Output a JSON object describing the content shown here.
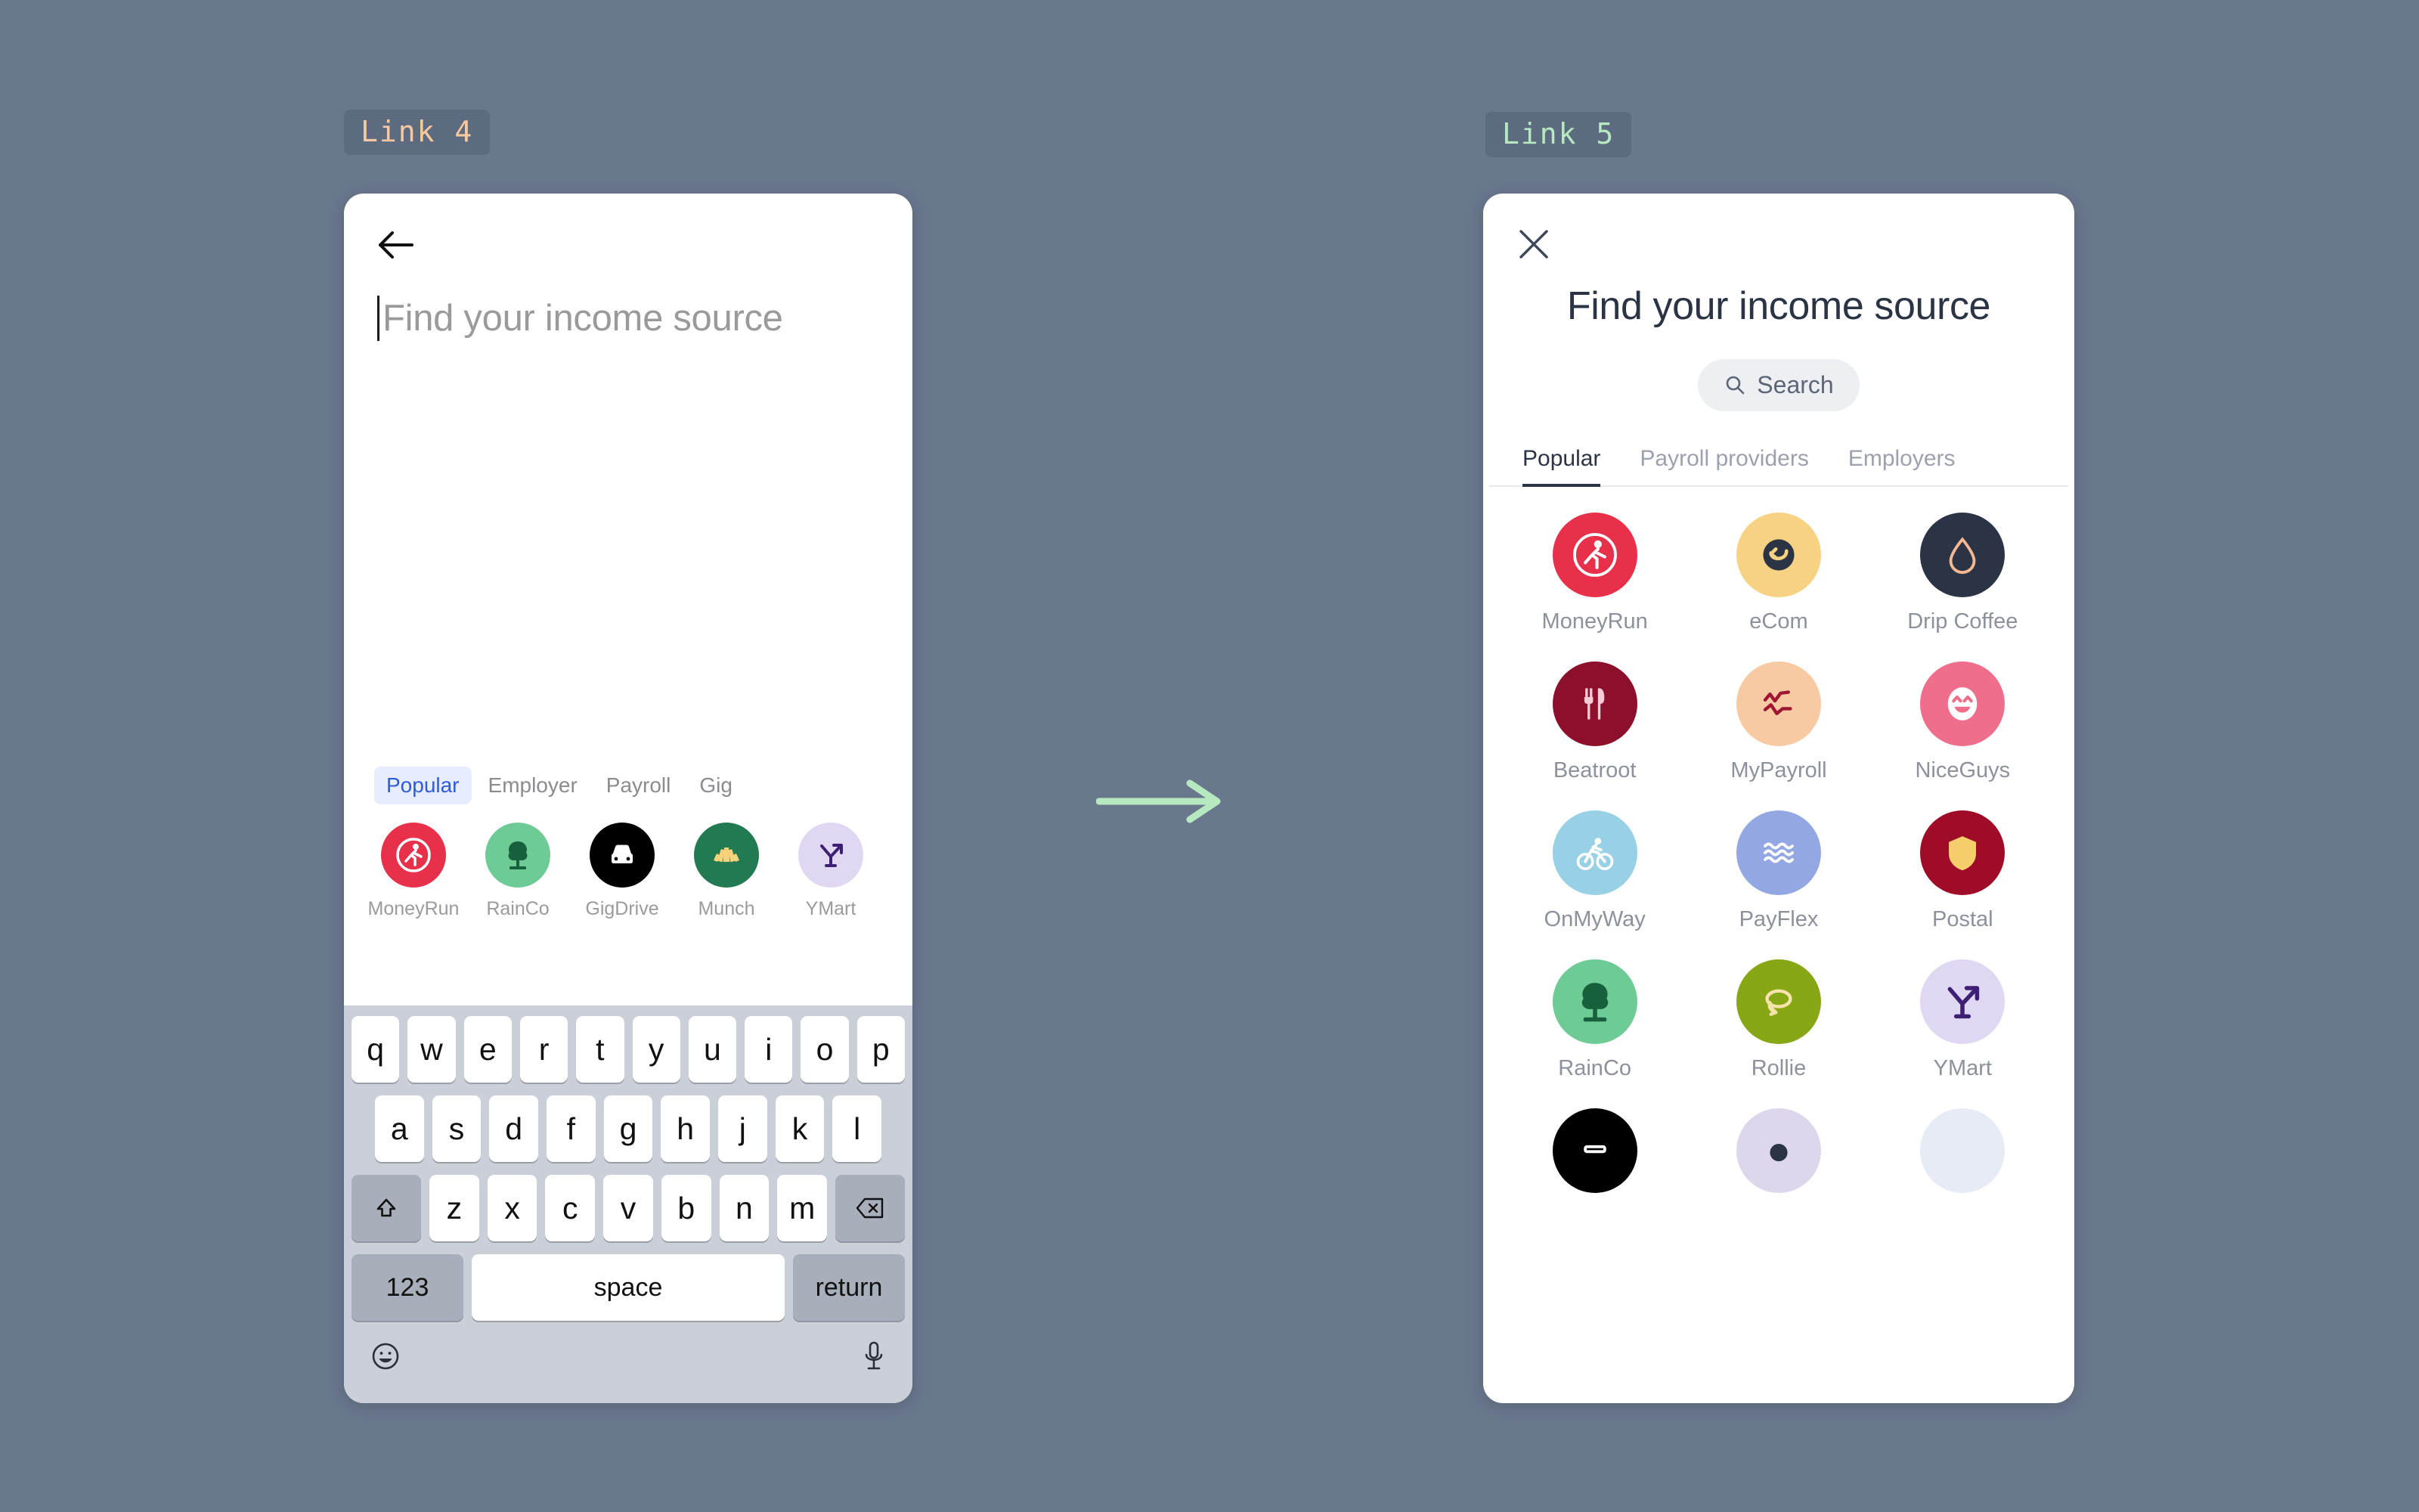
{
  "theme": {
    "background": "#6a788e",
    "chip_bg": "#5d6b80",
    "chip_left_color": "#f8c8a0",
    "chip_right_color": "#b6e9c0",
    "arrow_color": "#b6e9c0",
    "accent_blue": "#2f5bd8",
    "accent_blue_bg": "#e7edfd",
    "dark_text": "#2b3445",
    "muted_text": "#9a9a9f"
  },
  "chips": {
    "left_label": "Link 4",
    "right_label": "Link 5"
  },
  "arrow": {
    "icon": "arrow-right-icon"
  },
  "left_screen": {
    "back_icon": "back-arrow-icon",
    "search_placeholder": "Find your income source",
    "search_value": "",
    "tabs": [
      {
        "label": "Popular",
        "active": true
      },
      {
        "label": "Employer",
        "active": false
      },
      {
        "label": "Payroll",
        "active": false
      },
      {
        "label": "Gig",
        "active": false
      }
    ],
    "items": [
      {
        "label": "MoneyRun",
        "icon": "running-person-icon",
        "bg": "#e8304a",
        "fg": "#ffffff"
      },
      {
        "label": "RainCo",
        "icon": "tree-icon",
        "bg": "#6ecb96",
        "fg": "#17603c"
      },
      {
        "label": "GigDrive",
        "icon": "car-icon",
        "bg": "#000000",
        "fg": "#ffffff"
      },
      {
        "label": "Munch",
        "icon": "fan-shell-icon",
        "bg": "#227a52",
        "fg": "#f8d37a"
      },
      {
        "label": "YMart",
        "icon": "y-arrow-icon",
        "bg": "#e0d8f2",
        "fg": "#3d1f73"
      }
    ],
    "keyboard": {
      "row1": [
        "q",
        "w",
        "e",
        "r",
        "t",
        "y",
        "u",
        "i",
        "o",
        "p"
      ],
      "row2": [
        "a",
        "s",
        "d",
        "f",
        "g",
        "h",
        "j",
        "k",
        "l"
      ],
      "row3": [
        "z",
        "x",
        "c",
        "v",
        "b",
        "n",
        "m"
      ],
      "shift_icon": "shift-up-icon",
      "backspace_icon": "backspace-icon",
      "num_label": "123",
      "space_label": "space",
      "return_label": "return",
      "emoji_icon": "emoji-smiley-icon",
      "mic_icon": "microphone-icon"
    }
  },
  "right_screen": {
    "close_icon": "close-x-icon",
    "title": "Find your income source",
    "search_label": "Search",
    "search_icon": "magnifier-icon",
    "tabs": [
      {
        "label": "Popular",
        "active": true
      },
      {
        "label": "Payroll providers",
        "active": false
      },
      {
        "label": "Employers",
        "active": false
      }
    ],
    "items": [
      {
        "label": "MoneyRun",
        "icon": "running-person-icon",
        "bg": "#e8304a",
        "fg": "#ffffff"
      },
      {
        "label": "eCom",
        "icon": "smile-arrow-icon",
        "bg": "#f7d282",
        "fg": "#2b3445"
      },
      {
        "label": "Drip Coffee",
        "icon": "water-drop-icon",
        "bg": "#2b3445",
        "fg": "#f6b893"
      },
      {
        "label": "Beatroot",
        "icon": "fork-knife-icon",
        "bg": "#8c0f2c",
        "fg": "#f7ccd4"
      },
      {
        "label": "MyPayroll",
        "icon": "zigzag-lines-icon",
        "bg": "#f8caa4",
        "fg": "#a01630"
      },
      {
        "label": "NiceGuys",
        "icon": "smiley-face-icon",
        "bg": "#ef6e8c",
        "fg": "#ffffff"
      },
      {
        "label": "OnMyWay",
        "icon": "cyclist-icon",
        "bg": "#98d0e6",
        "fg": "#ffffff"
      },
      {
        "label": "PayFlex",
        "icon": "waves-icon",
        "bg": "#93a7e2",
        "fg": "#ffffff"
      },
      {
        "label": "Postal",
        "icon": "shield-icon",
        "bg": "#9e0c27",
        "fg": "#f4cf6a"
      },
      {
        "label": "RainCo",
        "icon": "tree-icon",
        "bg": "#6ecb96",
        "fg": "#17603c"
      },
      {
        "label": "Rollie",
        "icon": "loop-arrow-icon",
        "bg": "#87a715",
        "fg": "#f7e3ab"
      },
      {
        "label": "YMart",
        "icon": "y-arrow-icon",
        "bg": "#e0d8f2",
        "fg": "#3d1f73"
      },
      {
        "label": "",
        "icon": "briefcase-icon",
        "bg": "#000000",
        "fg": "#ffffff"
      },
      {
        "label": "",
        "icon": "circle-icon",
        "bg": "#ded6ea",
        "fg": "#2b3445"
      },
      {
        "label": "",
        "icon": "blank-icon",
        "bg": "#e6ebf6",
        "fg": "#ffffff"
      }
    ]
  }
}
